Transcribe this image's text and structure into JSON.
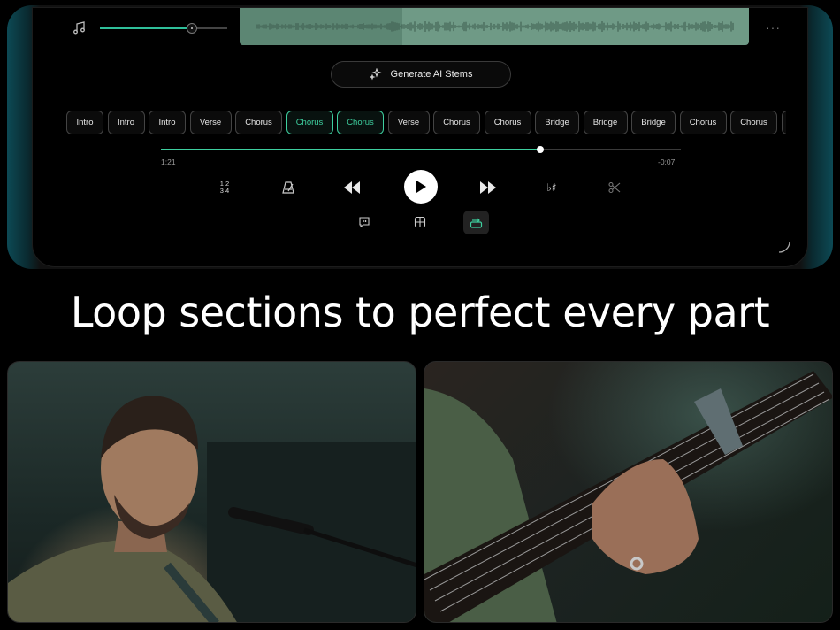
{
  "player": {
    "ai_button_label": "Generate AI Stems",
    "volume_level": 0.72,
    "waveform_played_fraction": 0.32,
    "progress_fraction": 0.73,
    "time_elapsed": "1:21",
    "time_remaining": "-0:07",
    "time_signature_top": "1 2",
    "time_signature_bottom": "3 4",
    "sections": [
      {
        "label": "Intro",
        "active": false
      },
      {
        "label": "Intro",
        "active": false
      },
      {
        "label": "Intro",
        "active": false
      },
      {
        "label": "Verse",
        "active": false
      },
      {
        "label": "Chorus",
        "active": false
      },
      {
        "label": "Chorus",
        "active": true
      },
      {
        "label": "Chorus",
        "active": true
      },
      {
        "label": "Verse",
        "active": false
      },
      {
        "label": "Chorus",
        "active": false
      },
      {
        "label": "Chorus",
        "active": false
      },
      {
        "label": "Bridge",
        "active": false
      },
      {
        "label": "Bridge",
        "active": false
      },
      {
        "label": "Bridge",
        "active": false
      },
      {
        "label": "Chorus",
        "active": false
      },
      {
        "label": "Chorus",
        "active": false
      },
      {
        "label": "",
        "active": false
      }
    ],
    "icons": {
      "music": "music-note-icon",
      "more": "more-dots-icon",
      "sparkle": "sparkle-icon",
      "metronome": "metronome-icon",
      "rewind": "rewind-icon",
      "play": "play-icon",
      "fast_forward": "fast-forward-icon",
      "key": "flat-sharp-icon",
      "scissors": "scissors-icon",
      "lyrics": "lyrics-icon",
      "grid": "chord-grid-icon",
      "loop": "loop-icon"
    },
    "colors": {
      "accent": "#3ecf9f",
      "waveform": "#6f9a86"
    }
  },
  "headline": "Loop sections to perfect every part",
  "photos": {
    "left": "singer-at-microphone",
    "right": "hand-on-guitar-fretboard-with-capo"
  }
}
